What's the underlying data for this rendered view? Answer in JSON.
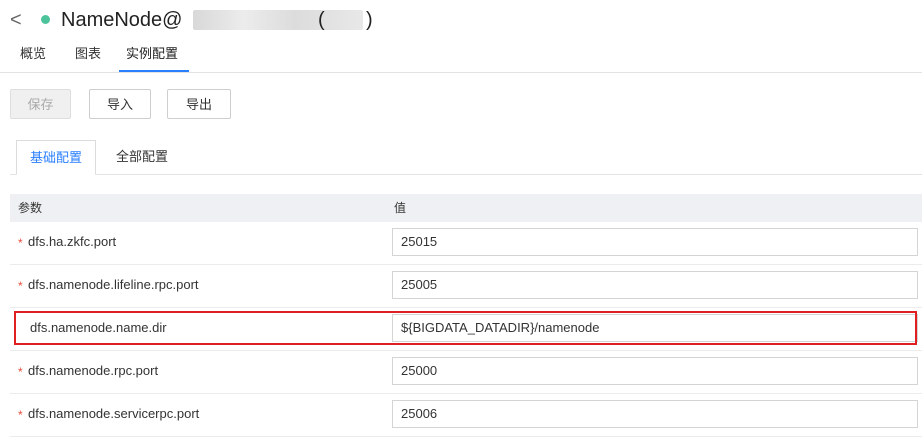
{
  "header": {
    "back_glyph": "<",
    "title": "NameNode@",
    "title_paren_open": "(",
    "title_paren_close": ")",
    "status_color": "#4cc39a"
  },
  "tabs": [
    {
      "label": "概览",
      "active": false
    },
    {
      "label": "图表",
      "active": false
    },
    {
      "label": "实例配置",
      "active": true
    }
  ],
  "toolbar": {
    "save_label": "保存",
    "import_label": "导入",
    "export_label": "导出"
  },
  "subtabs": [
    {
      "label": "基础配置",
      "active": true
    },
    {
      "label": "全部配置",
      "active": false
    }
  ],
  "table": {
    "col_param": "参数",
    "col_value": "值",
    "rows": [
      {
        "name": "dfs.ha.zkfc.port",
        "value": "25015",
        "required": true
      },
      {
        "name": "dfs.namenode.lifeline.rpc.port",
        "value": "25005",
        "required": true
      },
      {
        "name": "dfs.namenode.name.dir",
        "value": "${BIGDATA_DATADIR}/namenode",
        "required": false,
        "highlighted": true
      },
      {
        "name": "dfs.namenode.rpc.port",
        "value": "25000",
        "required": true
      },
      {
        "name": "dfs.namenode.servicerpc.port",
        "value": "25006",
        "required": true
      }
    ],
    "required_mark": "*"
  },
  "colors": {
    "accent": "#2a7fff",
    "highlight_border": "#e02020",
    "required": "#e74c3c"
  }
}
